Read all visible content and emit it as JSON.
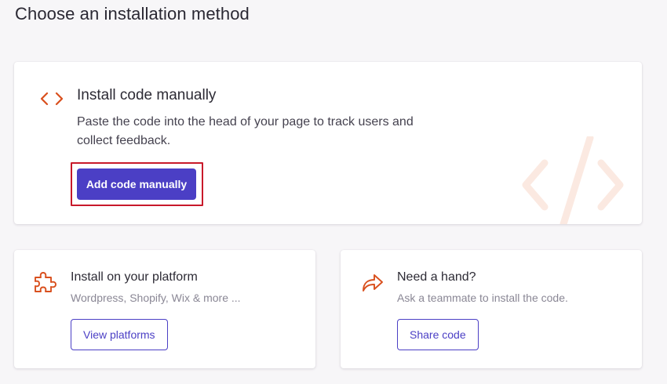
{
  "page": {
    "title": "Choose an installation method"
  },
  "manual": {
    "icon": "code-brackets-icon",
    "title": "Install code manually",
    "description": "Paste the code into the head of your page to track users and collect feedback.",
    "button_label": "Add code manually",
    "watermark_icon": "code-slash-icon"
  },
  "platform": {
    "icon": "puzzle-piece-icon",
    "title": "Install on your platform",
    "description": "Wordpress, Shopify, Wix & more ...",
    "button_label": "View platforms"
  },
  "hand": {
    "icon": "share-arrow-icon",
    "title": "Need a hand?",
    "description": "Ask a teammate to install the code.",
    "button_label": "Share code"
  },
  "colors": {
    "accent": "#4b3fc5",
    "icon_orange": "#d9501e",
    "highlight": "#c8192a",
    "background": "#f7f6f8"
  }
}
